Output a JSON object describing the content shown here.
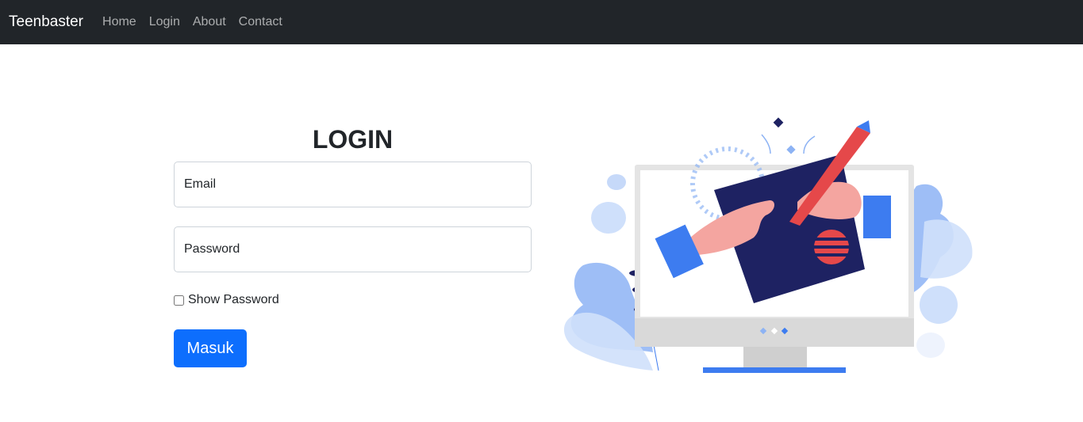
{
  "navbar": {
    "brand": "Teenbaster",
    "links": [
      "Home",
      "Login",
      "About",
      "Contact"
    ]
  },
  "login": {
    "title": "LOGIN",
    "email_placeholder": "Email",
    "password_placeholder": "Password",
    "show_password_label": "Show Password",
    "show_password_checked": false,
    "submit_label": "Masuk"
  },
  "colors": {
    "navbar_bg": "#212529",
    "primary": "#0d6efd",
    "illustration_navy": "#1e2262",
    "illustration_red": "#e5484a",
    "illustration_blue": "#3d7cf0"
  },
  "illustration": {
    "icon": "computer-drawing-illustration"
  }
}
